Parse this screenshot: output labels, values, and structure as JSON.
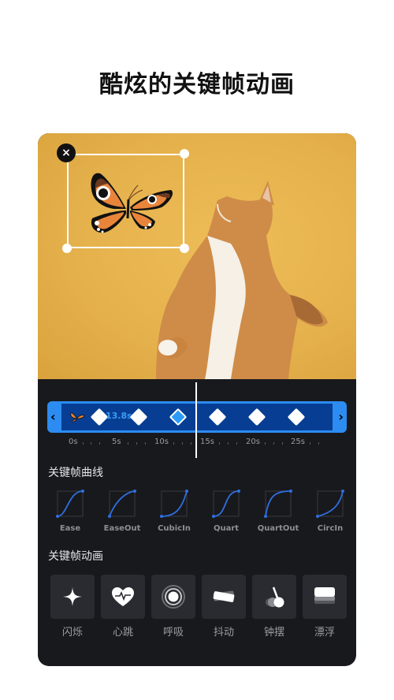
{
  "headline": "酷炫的关键帧动画",
  "canvas": {
    "close_icon": "×",
    "sticker": "butterfly"
  },
  "timeline": {
    "left_arrow": "‹",
    "right_arrow": "›",
    "clip_time": "13.8s",
    "keyframe_count": 6,
    "active_keyframe_index": 2,
    "ruler_ticks": [
      "0s",
      "5s",
      "10s",
      "15s",
      "20s",
      "25s"
    ],
    "track_color": "#2c8cf2",
    "track_inner_color": "#073e94"
  },
  "curves_section": {
    "title": "关键帧曲线",
    "items": [
      {
        "label": "Ease"
      },
      {
        "label": "EaseOut"
      },
      {
        "label": "CubicIn"
      },
      {
        "label": "Quart"
      },
      {
        "label": "QuartOut"
      },
      {
        "label": "CircIn"
      }
    ],
    "curve_color": "#2f6fe0"
  },
  "animations_section": {
    "title": "关键帧动画",
    "items": [
      {
        "label": "闪烁",
        "icon": "sparkle-icon"
      },
      {
        "label": "心跳",
        "icon": "heartbeat-icon"
      },
      {
        "label": "呼吸",
        "icon": "breath-icon"
      },
      {
        "label": "抖动",
        "icon": "shake-icon"
      },
      {
        "label": "钟摆",
        "icon": "pendulum-icon"
      },
      {
        "label": "漂浮",
        "icon": "float-icon"
      }
    ]
  }
}
